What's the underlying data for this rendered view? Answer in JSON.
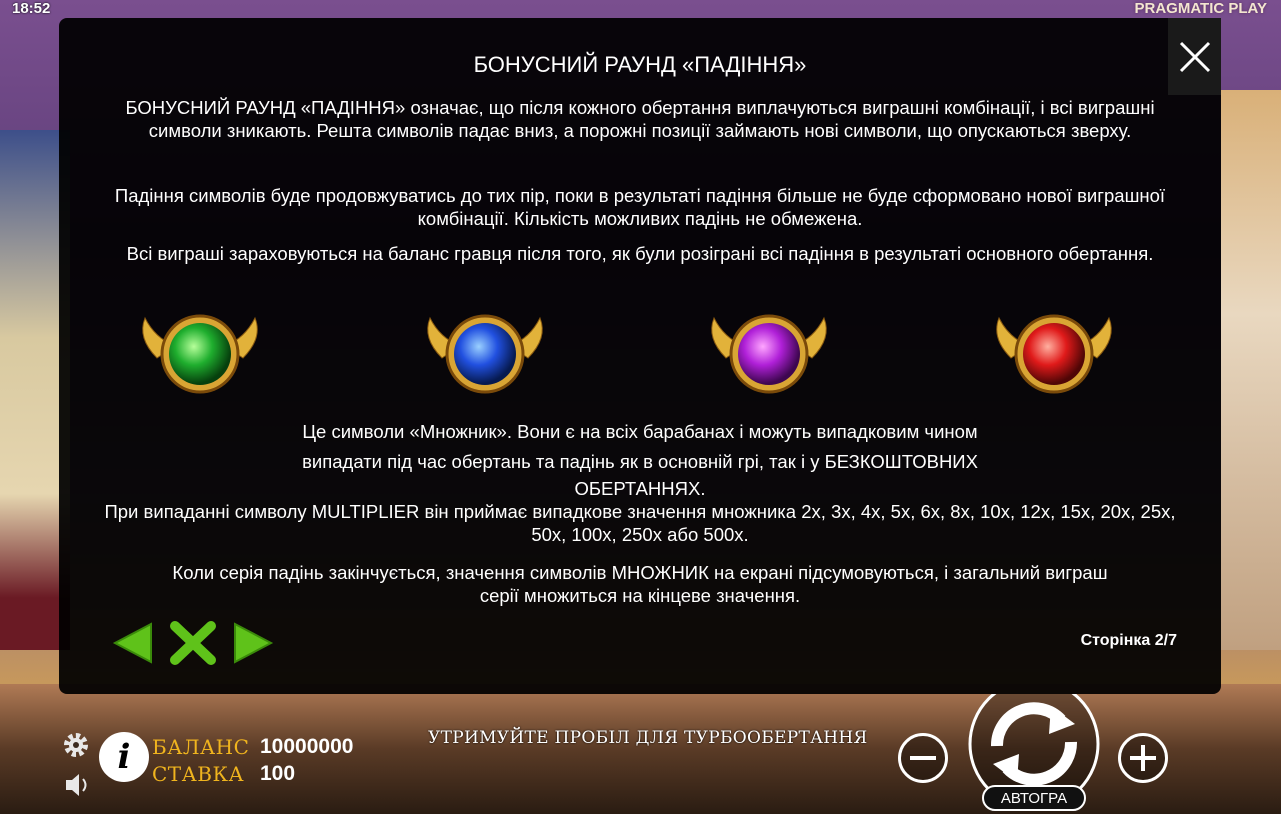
{
  "status_bar": {
    "time": "18:52",
    "brand": "PRAGMATIC PLAY"
  },
  "modal": {
    "title": "БОНУСНИЙ РАУНД «ПАДІННЯ»",
    "paragraphs": [
      "БОНУСНИЙ РАУНД «ПАДІННЯ» означає, що після кожного обертання виплачуються виграшні комбінації, і всі виграшні символи зникають. Решта символів падає вниз, а порожні позиції займають нові символи, що опускаються зверху.",
      "Падіння символів буде продовжуватись до тих пір, поки в результаті падіння більше не буде сформовано нової виграшної комбінації. Кількість можливих падінь не обмежена.",
      "Всі виграші зараховуються на баланс гравця після того, як були розіграні всі падіння в результаті основного обертання."
    ],
    "multiplier_text": {
      "line1": "Це символи «Множник». Вони є на всіх барабанах і можуть випадковим чином",
      "line2": "випадати під час обертань та падінь як в основній грі, так і у БЕЗКОШТОВНИХ",
      "line3": "ОБЕРТАННЯХ.",
      "line4": "При випаданні символу MULTIPLIER він приймає випадкове значення множника 2x, 3x, 4x, 5x, 6x, 8x, 10x, 12x, 15x, 20x, 25x, 50x, 100x, 250x або 500x."
    },
    "final_text": "Коли серія падінь закінчується, значення символів МНОЖНИК на екрані підсумовуються, і загальний виграш серії множиться на кінцеве значення.",
    "page_indicator": "Сторінка 2/7",
    "orbs": [
      {
        "icon": "green-orb-icon",
        "color": "#1fae2e"
      },
      {
        "icon": "blue-orb-icon",
        "color": "#2150e0"
      },
      {
        "icon": "purple-orb-icon",
        "color": "#b020d8"
      },
      {
        "icon": "red-orb-icon",
        "color": "#e01a1a"
      }
    ],
    "accent_green": "#5fc21a"
  },
  "bottom_bar": {
    "balance_label": "БАЛАНС",
    "balance_value": "10000000",
    "bet_label": "СТАВКА",
    "bet_value": "100",
    "hint": "УТРИМУЙТЕ ПРОБІЛ ДЛЯ ТУРБООБЕРТАННЯ",
    "autoplay_label": "АВТОГРА",
    "label_color": "#f0b41e"
  }
}
